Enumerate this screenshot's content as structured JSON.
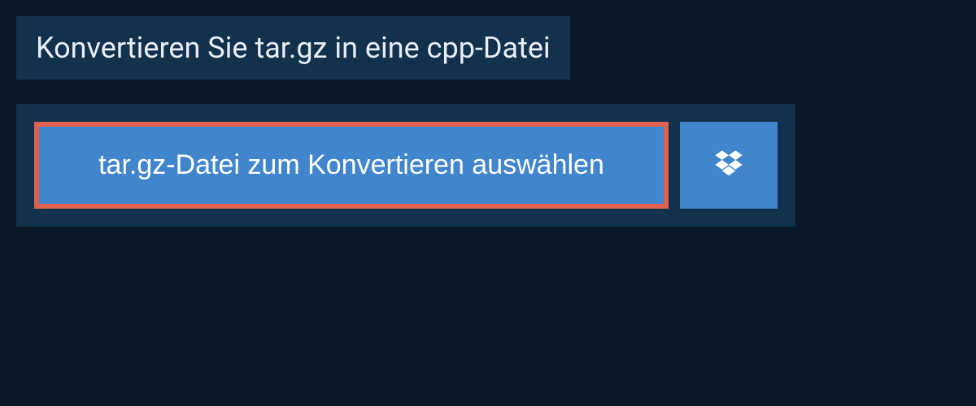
{
  "header": {
    "title": "Konvertieren Sie tar.gz in eine cpp-Datei"
  },
  "upload": {
    "select_label": "tar.gz-Datei zum Konvertieren auswählen"
  },
  "colors": {
    "page_bg": "#0a1929",
    "panel_bg": "#12314d",
    "button_bg": "#4185cc",
    "highlight_border": "#e0624e",
    "text_light": "#e8eef5"
  }
}
